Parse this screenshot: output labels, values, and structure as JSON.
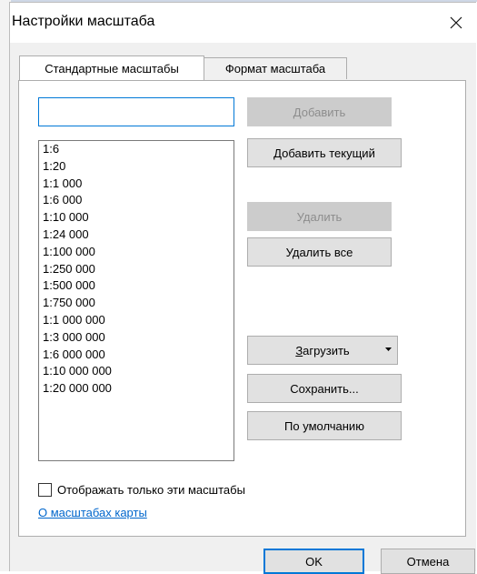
{
  "window": {
    "title": "Настройки масштаба"
  },
  "tabs": [
    {
      "label": "Стандартные масштабы",
      "active": true
    },
    {
      "label": "Формат масштаба",
      "active": false
    }
  ],
  "scale_input": {
    "value": "",
    "placeholder": ""
  },
  "buttons": {
    "add": "Добавить",
    "add_current": "Добавить текущий",
    "delete": "Удалить",
    "delete_all": "Удалить все",
    "load_underlined": "З",
    "load_rest": "агрузить",
    "save": "Сохранить...",
    "default": "По умолчанию",
    "ok": "OK",
    "cancel": "Отмена"
  },
  "scales": [
    "1:6",
    "1:20",
    "1:1 000",
    "1:6 000",
    "1:10 000",
    "1:24 000",
    "1:100 000",
    "1:250 000",
    "1:500 000",
    "1:750 000",
    "1:1 000 000",
    "1:3 000 000",
    "1:6 000 000",
    "1:10 000 000",
    "1:20 000 000"
  ],
  "checkbox": {
    "label": "Отображать только эти масштабы",
    "checked": false
  },
  "link": {
    "label": "О масштабах карты"
  },
  "colors": {
    "accent": "#0078d7",
    "link": "#0066cc",
    "disabled_bg": "#cccccc",
    "disabled_text": "#8d8d8d"
  },
  "icons": {
    "close": "close-icon",
    "dropdown": "dropdown-arrow-icon"
  }
}
